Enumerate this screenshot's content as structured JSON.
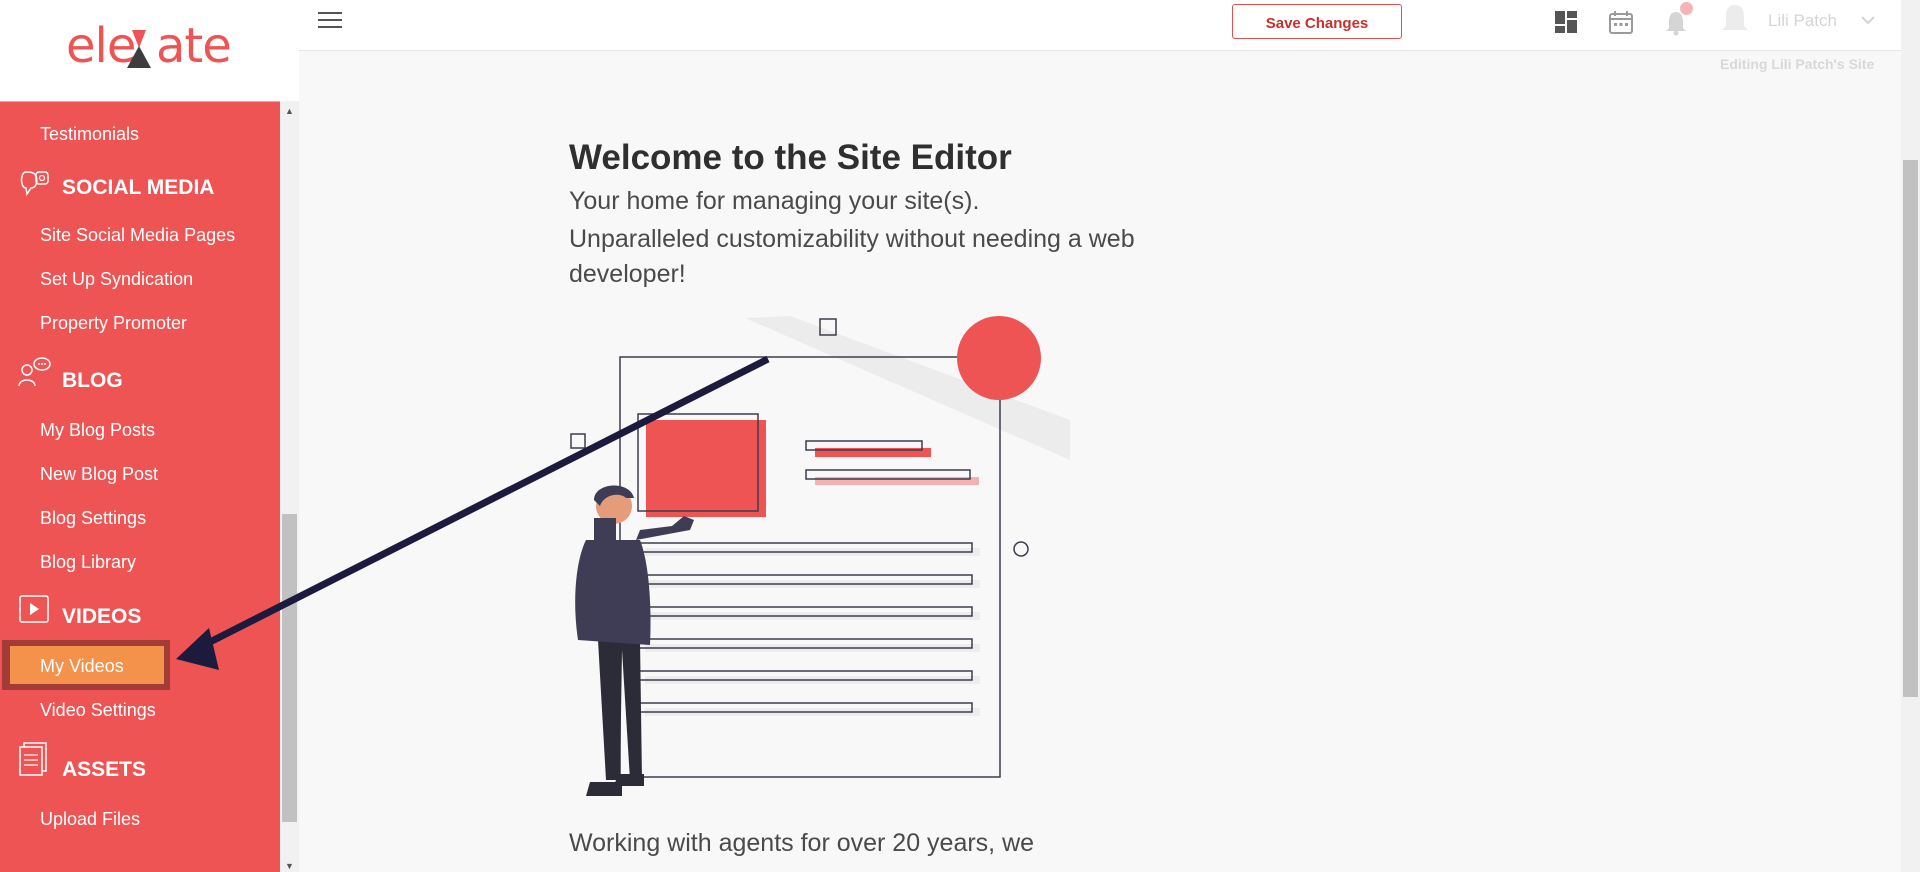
{
  "logo": {
    "text": "eleVate"
  },
  "sidebar": {
    "items": [
      {
        "label": "Testimonials"
      },
      {
        "label": "Site Social Media Pages"
      },
      {
        "label": "Set Up Syndication"
      },
      {
        "label": "Property Promoter"
      },
      {
        "label": "My Blog Posts"
      },
      {
        "label": "New Blog Post"
      },
      {
        "label": "Blog Settings"
      },
      {
        "label": "Blog Library"
      },
      {
        "label": "My Videos"
      },
      {
        "label": "Video Settings"
      },
      {
        "label": "Upload Files"
      }
    ],
    "sections": [
      {
        "label": "SOCIAL MEDIA",
        "icon": "social-media-icon"
      },
      {
        "label": "BLOG",
        "icon": "blog-icon"
      },
      {
        "label": "VIDEOS",
        "icon": "video-icon"
      },
      {
        "label": "ASSETS",
        "icon": "assets-icon"
      }
    ],
    "active_item": "My Videos"
  },
  "header": {
    "save_label": "Save Changes",
    "user_name": "Lili Patch",
    "editing_label": "Editing Lili Patch's Site"
  },
  "main": {
    "title": "Welcome to the Site Editor",
    "subtitle": "Your home for managing your site(s).",
    "tagline": "Unparalleled customizability without needing a web developer!",
    "bottom_text": "Working with agents for over 20 years, we"
  },
  "colors": {
    "accent": "#ee5453",
    "active_item": "#f4914a",
    "active_border": "#a33b36",
    "arrow": "#1c1a3d"
  }
}
